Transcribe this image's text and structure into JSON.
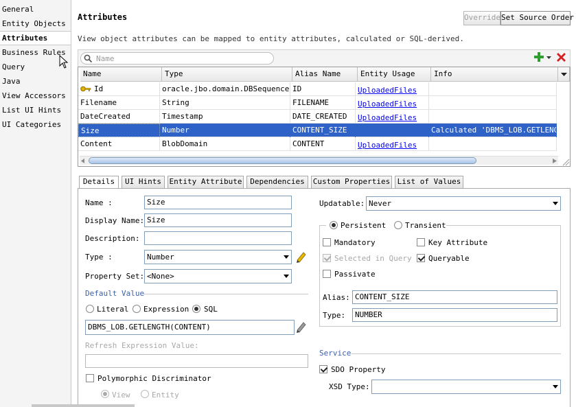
{
  "sidebar": {
    "items": [
      {
        "label": "General"
      },
      {
        "label": "Entity Objects"
      },
      {
        "label": "Attributes"
      },
      {
        "label": "Business Rules"
      },
      {
        "label": "Query"
      },
      {
        "label": "Java"
      },
      {
        "label": "View Accessors"
      },
      {
        "label": "List UI Hints"
      },
      {
        "label": "UI Categories"
      }
    ],
    "active": "Attributes"
  },
  "header": {
    "title": "Attributes",
    "description": "View object attributes can be mapped to entity attributes, calculated or SQL-derived.",
    "override_label": "Override",
    "source_order_label": "Set Source Order"
  },
  "search": {
    "placeholder": "Name"
  },
  "table": {
    "columns": [
      "Name",
      "Type",
      "Alias Name",
      "Entity Usage",
      "Info"
    ],
    "rows": [
      {
        "name": "Id",
        "type": "oracle.jbo.domain.DBSequence",
        "alias": "ID",
        "usage": "UploadedFiles",
        "info": "",
        "key": true
      },
      {
        "name": "Filename",
        "type": "String",
        "alias": "FILENAME",
        "usage": "UploadedFiles",
        "info": ""
      },
      {
        "name": "DateCreated",
        "type": "Timestamp",
        "alias": "DATE_CREATED",
        "usage": "UploadedFiles",
        "info": ""
      },
      {
        "name": "Size",
        "type": "Number",
        "alias": "CONTENT_SIZE",
        "usage": "",
        "info": "Calculated 'DBMS_LOB.GETLENGTH(",
        "selected": true
      },
      {
        "name": "Content",
        "type": "BlobDomain",
        "alias": "CONTENT",
        "usage": "UploadedFiles",
        "info": ""
      }
    ]
  },
  "tabs": [
    "Details",
    "UI Hints",
    "Entity Attribute",
    "Dependencies",
    "Custom Properties",
    "List of Values"
  ],
  "active_tab": "Details",
  "details": {
    "name_label": "Name :",
    "name_value": "Size",
    "display_name_label": "Display Name:",
    "display_name_value": "Size",
    "description_label": "Description:",
    "description_value": "",
    "type_label": "Type :",
    "type_value": "Number",
    "property_set_label": "Property Set:",
    "property_set_value": "<None>",
    "default_value_title": "Default Value",
    "opt_literal": "Literal",
    "opt_expression": "Expression",
    "opt_sql": "SQL",
    "sql_value": "DBMS_LOB.GETLENGTH(CONTENT)",
    "refresh_label": "Refresh Expression Value:",
    "polymorphic_label": "Polymorphic Discriminator",
    "opt_view": "View",
    "opt_entity": "Entity"
  },
  "right": {
    "updatable_label": "Updatable:",
    "updatable_value": "Never",
    "persistent_label": "Persistent",
    "transient_label": "Transient",
    "mandatory_label": "Mandatory",
    "key_attribute_label": "Key Attribute",
    "selected_in_query_label": "Selected in Query",
    "queryable_label": "Queryable",
    "passivate_label": "Passivate",
    "alias_label": "Alias:",
    "alias_value": "CONTENT_SIZE",
    "type_label": "Type:",
    "type_value": "NUMBER",
    "service_title": "Service",
    "sdo_label": "SDO Property",
    "xsd_label": "XSD Type:",
    "xsd_value": ""
  },
  "colors": {
    "selection": "#2f62c6",
    "section": "#3b5fa8",
    "link": "#0000ee"
  }
}
